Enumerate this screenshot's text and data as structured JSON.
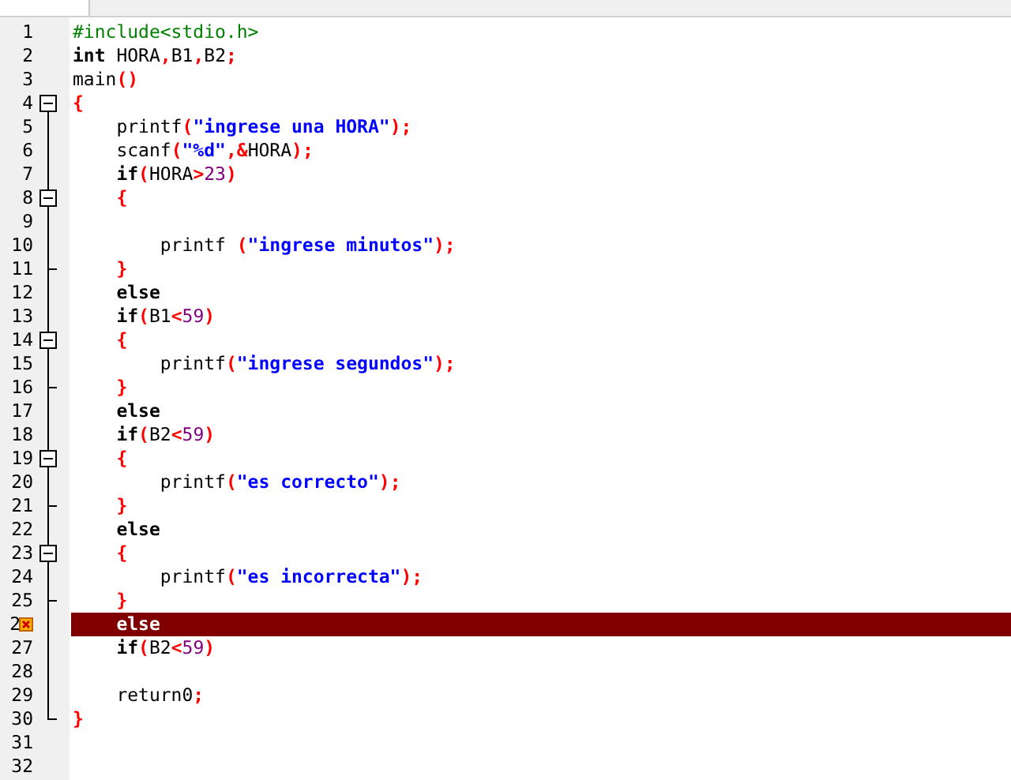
{
  "editor": {
    "lines": [
      {
        "number": "1",
        "kind": "plain",
        "tokens": [
          {
            "kind": "pre",
            "text": "#include<stdio.h>"
          }
        ]
      },
      {
        "number": "2",
        "kind": "plain",
        "tokens": [
          {
            "kind": "kw",
            "text": "int"
          },
          {
            "kind": "plain",
            "text": " HORA"
          },
          {
            "kind": "op",
            "text": ","
          },
          {
            "kind": "plain",
            "text": "B1"
          },
          {
            "kind": "op",
            "text": ","
          },
          {
            "kind": "plain",
            "text": "B2"
          },
          {
            "kind": "op",
            "text": ";"
          }
        ]
      },
      {
        "number": "3",
        "kind": "plain",
        "tokens": [
          {
            "kind": "plain",
            "text": "main"
          },
          {
            "kind": "op",
            "text": "()"
          }
        ]
      },
      {
        "number": "4",
        "kind": "fold-start-outer",
        "tokens": [
          {
            "kind": "op",
            "text": "{"
          }
        ]
      },
      {
        "number": "5",
        "kind": "fold-middle",
        "tokens": [
          {
            "kind": "plain",
            "text": "    printf"
          },
          {
            "kind": "op",
            "text": "("
          },
          {
            "kind": "str",
            "text": "\"ingrese una HORA\""
          },
          {
            "kind": "op",
            "text": ");"
          }
        ]
      },
      {
        "number": "6",
        "kind": "fold-middle",
        "tokens": [
          {
            "kind": "plain",
            "text": "    scanf"
          },
          {
            "kind": "op",
            "text": "("
          },
          {
            "kind": "str",
            "text": "\"%d\""
          },
          {
            "kind": "op",
            "text": ",&"
          },
          {
            "kind": "plain",
            "text": "HORA"
          },
          {
            "kind": "op",
            "text": ");"
          }
        ]
      },
      {
        "number": "7",
        "kind": "fold-middle",
        "tokens": [
          {
            "kind": "kw",
            "text": "    if"
          },
          {
            "kind": "op",
            "text": "("
          },
          {
            "kind": "plain",
            "text": "HORA"
          },
          {
            "kind": "op",
            "text": ">"
          },
          {
            "kind": "num",
            "text": "23"
          },
          {
            "kind": "op",
            "text": ")"
          }
        ]
      },
      {
        "number": "8",
        "kind": "fold-start",
        "tokens": [
          {
            "kind": "op",
            "text": "    {"
          }
        ]
      },
      {
        "number": "9",
        "kind": "fold-middle"
      },
      {
        "number": "10",
        "kind": "fold-middle",
        "tokens": [
          {
            "kind": "plain",
            "text": "        printf "
          },
          {
            "kind": "op",
            "text": "("
          },
          {
            "kind": "str",
            "text": "\"ingrese minutos\""
          },
          {
            "kind": "op",
            "text": ");"
          }
        ]
      },
      {
        "number": "11",
        "kind": "fold-end",
        "tokens": [
          {
            "kind": "op",
            "text": "    }"
          }
        ]
      },
      {
        "number": "12",
        "kind": "fold-middle",
        "tokens": [
          {
            "kind": "kw",
            "text": "    else"
          }
        ]
      },
      {
        "number": "13",
        "kind": "fold-middle",
        "tokens": [
          {
            "kind": "kw",
            "text": "    if"
          },
          {
            "kind": "op",
            "text": "("
          },
          {
            "kind": "plain",
            "text": "B1"
          },
          {
            "kind": "op",
            "text": "<"
          },
          {
            "kind": "num",
            "text": "59"
          },
          {
            "kind": "op",
            "text": ")"
          }
        ]
      },
      {
        "number": "14",
        "kind": "fold-start",
        "tokens": [
          {
            "kind": "op",
            "text": "    {"
          }
        ]
      },
      {
        "number": "15",
        "kind": "fold-middle",
        "tokens": [
          {
            "kind": "plain",
            "text": "        printf"
          },
          {
            "kind": "op",
            "text": "("
          },
          {
            "kind": "str",
            "text": "\"ingrese segundos\""
          },
          {
            "kind": "op",
            "text": ");"
          }
        ]
      },
      {
        "number": "16",
        "kind": "fold-end",
        "tokens": [
          {
            "kind": "op",
            "text": "    }"
          }
        ]
      },
      {
        "number": "17",
        "kind": "fold-middle",
        "tokens": [
          {
            "kind": "kw",
            "text": "    else"
          }
        ]
      },
      {
        "number": "18",
        "kind": "fold-middle",
        "tokens": [
          {
            "kind": "kw",
            "text": "    if"
          },
          {
            "kind": "op",
            "text": "("
          },
          {
            "kind": "plain",
            "text": "B2"
          },
          {
            "kind": "op",
            "text": "<"
          },
          {
            "kind": "num",
            "text": "59"
          },
          {
            "kind": "op",
            "text": ")"
          }
        ]
      },
      {
        "number": "19",
        "kind": "fold-start",
        "tokens": [
          {
            "kind": "op",
            "text": "    {"
          }
        ]
      },
      {
        "number": "20",
        "kind": "fold-middle",
        "tokens": [
          {
            "kind": "plain",
            "text": "        printf"
          },
          {
            "kind": "op",
            "text": "("
          },
          {
            "kind": "str",
            "text": "\"es correcto\""
          },
          {
            "kind": "op",
            "text": ");"
          }
        ]
      },
      {
        "number": "21",
        "kind": "fold-end",
        "tokens": [
          {
            "kind": "op",
            "text": "    }"
          }
        ]
      },
      {
        "number": "22",
        "kind": "fold-middle",
        "tokens": [
          {
            "kind": "kw",
            "text": "    else"
          }
        ]
      },
      {
        "number": "23",
        "kind": "fold-start",
        "tokens": [
          {
            "kind": "op",
            "text": "    {"
          }
        ]
      },
      {
        "number": "24",
        "kind": "fold-middle",
        "tokens": [
          {
            "kind": "plain",
            "text": "        printf"
          },
          {
            "kind": "op",
            "text": "("
          },
          {
            "kind": "str",
            "text": "\"es incorrecta\""
          },
          {
            "kind": "op",
            "text": ");"
          }
        ]
      },
      {
        "number": "25",
        "kind": "fold-end",
        "tokens": [
          {
            "kind": "op",
            "text": "    }"
          }
        ]
      },
      {
        "number": "2",
        "kind": "fold-middle",
        "error": true,
        "highlighted": true,
        "tokens": [
          {
            "kind": "kw",
            "text": "    else"
          }
        ]
      },
      {
        "number": "27",
        "kind": "fold-middle",
        "tokens": [
          {
            "kind": "kw",
            "text": "    if"
          },
          {
            "kind": "op",
            "text": "("
          },
          {
            "kind": "plain",
            "text": "B2"
          },
          {
            "kind": "op",
            "text": "<"
          },
          {
            "kind": "num",
            "text": "59"
          },
          {
            "kind": "op",
            "text": ")"
          }
        ]
      },
      {
        "number": "28",
        "kind": "fold-middle"
      },
      {
        "number": "29",
        "kind": "fold-middle",
        "tokens": [
          {
            "kind": "plain",
            "text": "    return0"
          },
          {
            "kind": "op",
            "text": ";"
          }
        ]
      },
      {
        "number": "30",
        "kind": "fold-last",
        "tokens": [
          {
            "kind": "op",
            "text": "}"
          }
        ]
      },
      {
        "number": "31",
        "kind": "plain"
      },
      {
        "number": "32",
        "kind": "plain"
      }
    ]
  }
}
